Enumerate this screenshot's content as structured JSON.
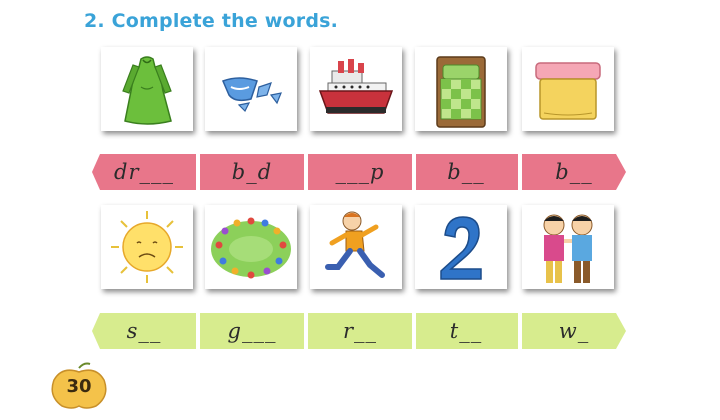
{
  "exercise": {
    "title": "2. Complete the words."
  },
  "row1": {
    "pictures": [
      "dress-picture",
      "broken-bowl-picture",
      "ship-picture",
      "bed-picture",
      "box-picture"
    ],
    "words": [
      "dr___",
      "b_d",
      "___p",
      "b__",
      "b__"
    ],
    "band_color": "#e8768a"
  },
  "row2": {
    "pictures": [
      "sun-picture",
      "children-circle-picture",
      "running-boy-picture",
      "number-two-picture",
      "two-boys-picture"
    ],
    "words": [
      "s__",
      "g___",
      "r__",
      "t__",
      "w_"
    ],
    "band_color": "#d7ec8e"
  },
  "page": {
    "number": "30"
  }
}
